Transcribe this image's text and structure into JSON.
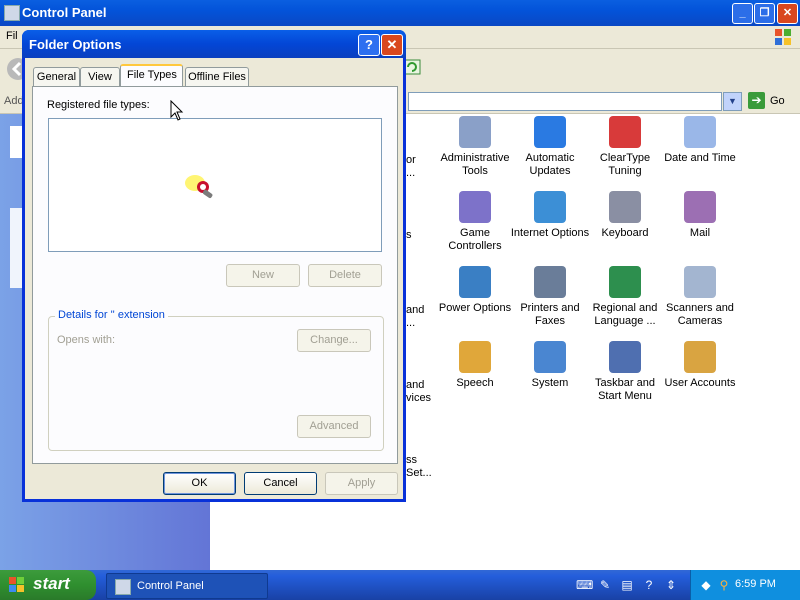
{
  "window": {
    "title": "Control Panel",
    "menu_partial": "Fil",
    "address_partial": "Add",
    "go_label": "Go"
  },
  "dialog": {
    "title": "Folder Options",
    "tabs": [
      {
        "label": "General"
      },
      {
        "label": "View"
      },
      {
        "label": "File Types"
      },
      {
        "label": "Offline Files"
      }
    ],
    "registered_label": "Registered file types:",
    "new_button": "New",
    "delete_button": "Delete",
    "details_legend": "Details for '' extension",
    "opens_with": "Opens with:",
    "change_button": "Change...",
    "advanced_button": "Advanced",
    "ok_button": "OK",
    "cancel_button": "Cancel",
    "apply_button": "Apply"
  },
  "items": [
    {
      "label": "Administrative Tools",
      "icon": "administrative-tools-icon"
    },
    {
      "label": "Automatic Updates",
      "icon": "automatic-updates-icon"
    },
    {
      "label": "ClearType Tuning",
      "icon": "cleartype-icon"
    },
    {
      "label": "Date and Time",
      "icon": "date-time-icon"
    },
    {
      "label": "Game Controllers",
      "icon": "game-controllers-icon"
    },
    {
      "label": "Internet Options",
      "icon": "internet-options-icon"
    },
    {
      "label": "Keyboard",
      "icon": "keyboard-icon"
    },
    {
      "label": "Mail",
      "icon": "mail-icon"
    },
    {
      "label": "Power Options",
      "icon": "power-options-icon"
    },
    {
      "label": "Printers and Faxes",
      "icon": "printers-icon"
    },
    {
      "label": "Regional and Language ...",
      "icon": "regional-icon"
    },
    {
      "label": "Scanners and Cameras",
      "icon": "scanners-icon"
    },
    {
      "label": "Speech",
      "icon": "speech-icon"
    },
    {
      "label": "System",
      "icon": "system-icon"
    },
    {
      "label": "Taskbar and Start Menu",
      "icon": "taskbar-icon"
    },
    {
      "label": "User Accounts",
      "icon": "user-accounts-icon"
    }
  ],
  "partial_labels": [
    "or",
    "...",
    "s",
    "and",
    "...",
    "and",
    "vices",
    "ss",
    "Set..."
  ],
  "taskbar": {
    "start_label": "start",
    "task_label": "Control Panel",
    "clock": "6:59 PM"
  }
}
